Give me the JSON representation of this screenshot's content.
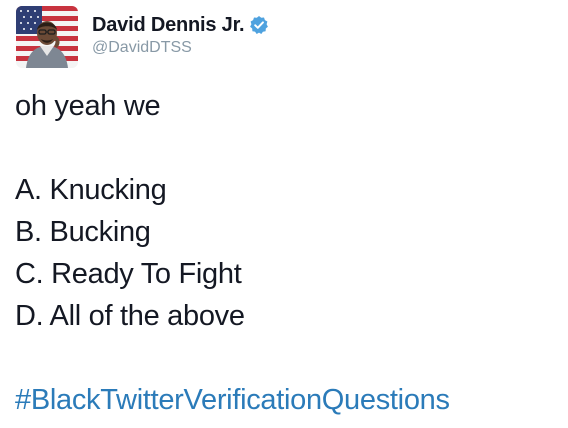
{
  "author": {
    "display_name": "David Dennis Jr.",
    "handle": "@DavidDTSS",
    "verified": true,
    "avatar_icon": "user-avatar-flag-background"
  },
  "tweet": {
    "intro": "oh yeah we",
    "options": [
      "A. Knucking",
      "B. Bucking",
      "C. Ready To Fight",
      "D. All of the above"
    ],
    "hashtag": "#BlackTwitterVerificationQuestions"
  },
  "colors": {
    "text": "#141823",
    "handle": "#8899a6",
    "hashtag": "#2b7bb9",
    "verified_badge": "#4fa2df"
  }
}
